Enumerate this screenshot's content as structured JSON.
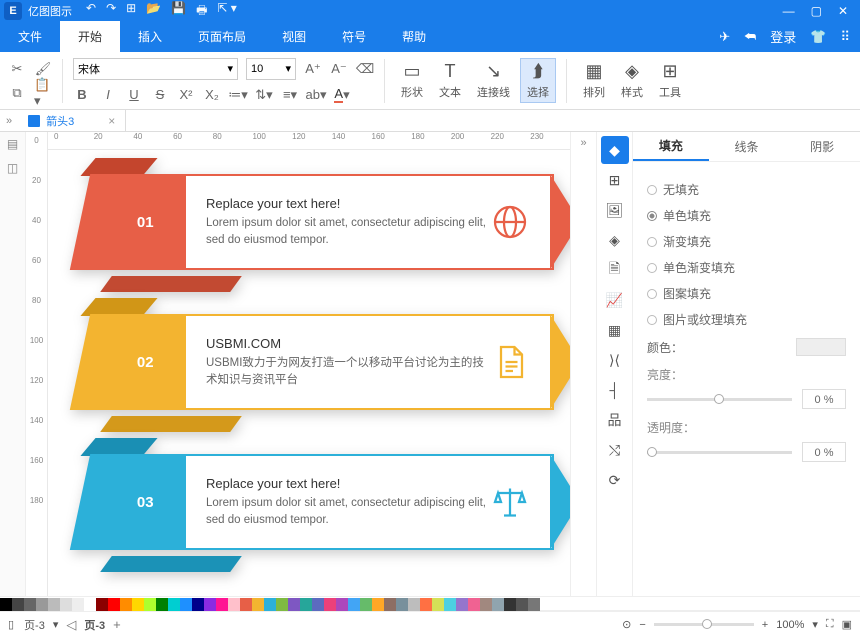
{
  "app_name": "亿图图示",
  "menu": [
    "文件",
    "开始",
    "插入",
    "页面布局",
    "视图",
    "符号",
    "帮助"
  ],
  "active_menu": 1,
  "login_label": "登录",
  "doc_tab": "箭头3",
  "font": {
    "family": "宋体",
    "size": "10"
  },
  "ribbon_tools": {
    "shape": "形状",
    "text": "文本",
    "connector": "连接线",
    "select": "选择",
    "arrange": "排列",
    "style": "样式",
    "tool": "工具"
  },
  "ruler_h": [
    "0",
    "20",
    "40",
    "60",
    "80",
    "100",
    "120",
    "140",
    "160",
    "180",
    "200",
    "220",
    "230"
  ],
  "ruler_v": [
    "0",
    "20",
    "40",
    "60",
    "80",
    "100",
    "120",
    "140",
    "160",
    "180"
  ],
  "cards": [
    {
      "num": "01",
      "title": "Replace your text here!",
      "desc": "Lorem ipsum dolor sit amet, consectetur adipiscing elit, sed do eiusmod tempor."
    },
    {
      "num": "02",
      "title": "USBMI.COM",
      "desc": "USBMI致力于为网友打造一个以移动平台讨论为主的技术知识与资讯平台"
    },
    {
      "num": "03",
      "title": "Replace your text here!",
      "desc": "Lorem ipsum dolor sit amet, consectetur adipiscing elit, sed do eiusmod tempor."
    }
  ],
  "right_panel": {
    "tabs": [
      "填充",
      "线条",
      "阴影"
    ],
    "active_tab": 0,
    "fill_options": [
      "无填充",
      "单色填充",
      "渐变填充",
      "单色渐变填充",
      "图案填充",
      "图片或纹理填充"
    ],
    "selected_fill": 1,
    "color_label": "颜色：",
    "brightness_label": "亮度：",
    "brightness_value": "0 %",
    "opacity_label": "透明度：",
    "opacity_value": "0 %"
  },
  "palette": [
    "#000",
    "#444",
    "#666",
    "#999",
    "#bbb",
    "#ddd",
    "#eee",
    "#fff",
    "#8b0000",
    "#ff0000",
    "#ff8c00",
    "#ffd700",
    "#adff2f",
    "#008000",
    "#00ced1",
    "#1e90ff",
    "#00008b",
    "#8a2be2",
    "#ff1493",
    "#ffc0cb",
    "#e75f47",
    "#f3b430",
    "#2cb0d9",
    "#7fba42",
    "#7e57c2",
    "#26a69a",
    "#5c6bc0",
    "#ec407a",
    "#ab47bc",
    "#42a5f5",
    "#66bb6a",
    "#ffa726",
    "#8d6e63",
    "#78909c",
    "#bdbdbd",
    "#ff7043",
    "#d4e157",
    "#4dd0e1",
    "#9575cd",
    "#f06292",
    "#a1887f",
    "#90a4ae",
    "#333",
    "#555",
    "#777"
  ],
  "status": {
    "page_selector": "页-3",
    "page_label": "页-3",
    "zoom": "100%"
  }
}
